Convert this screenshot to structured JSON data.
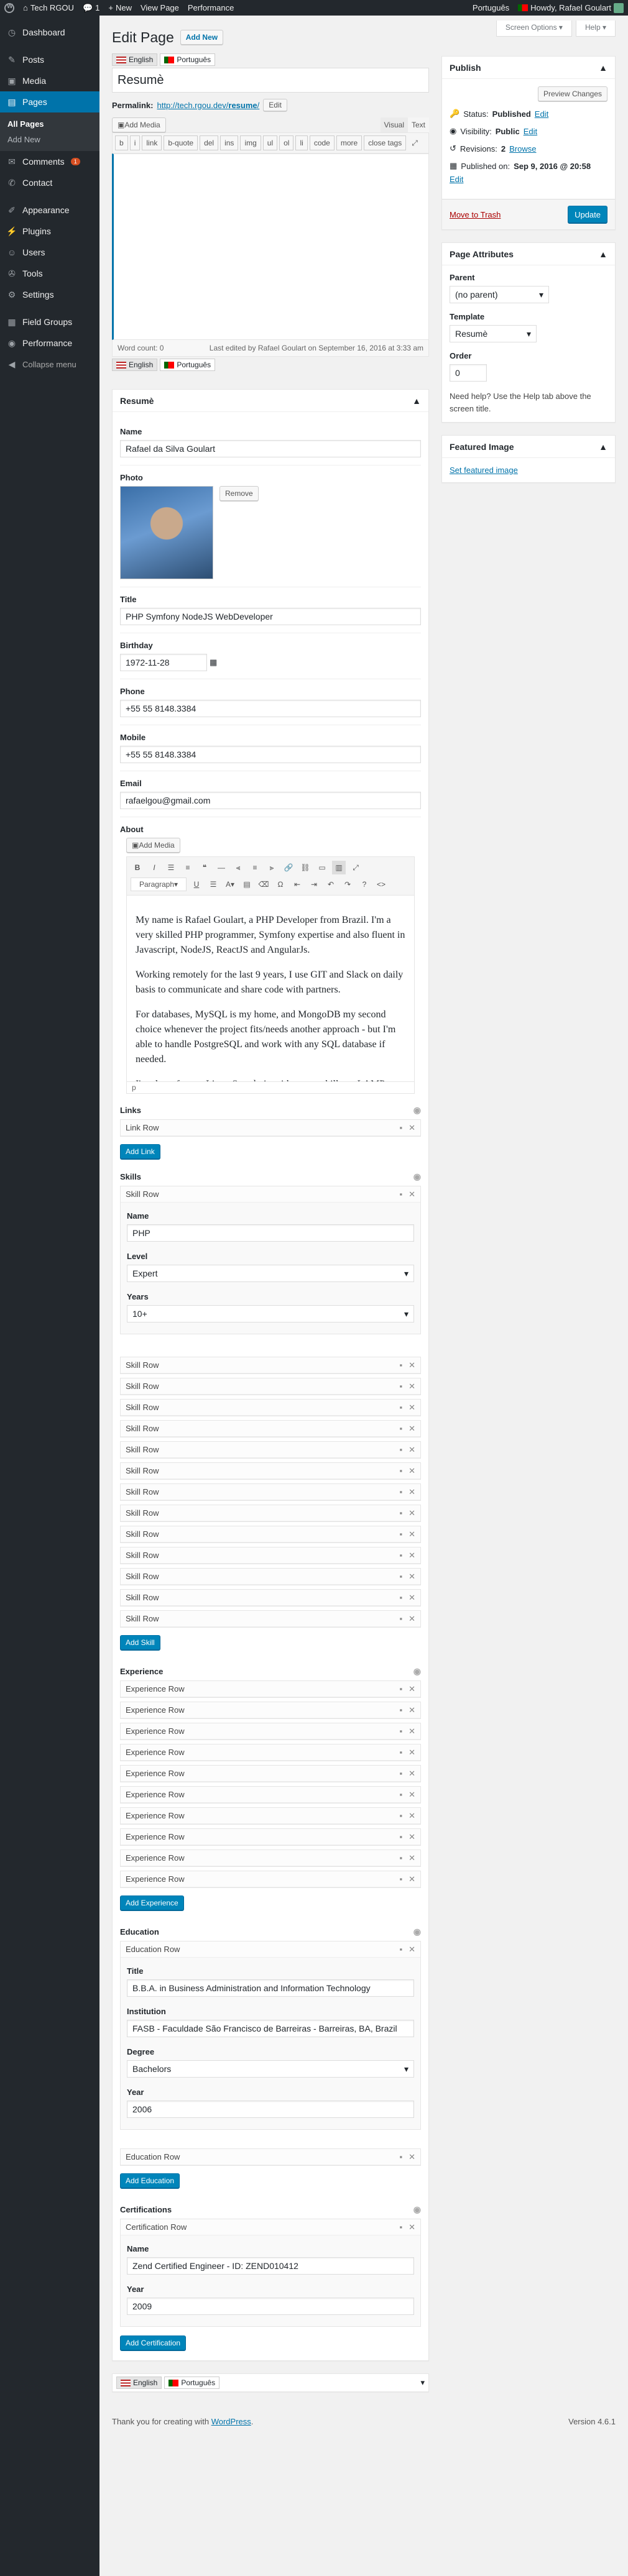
{
  "adminbar": {
    "site": "Tech RGOU",
    "comments": "1",
    "new": "New",
    "view_page": "View Page",
    "performance": "Performance",
    "language": "Português",
    "howdy": "Howdy, Rafael Goulart"
  },
  "sidebar": {
    "items": [
      {
        "label": "Dashboard",
        "icon": "dashboard-icon"
      },
      {
        "label": "Posts",
        "icon": "pin-icon"
      },
      {
        "label": "Media",
        "icon": "media-icon"
      },
      {
        "label": "Pages",
        "icon": "pages-icon"
      }
    ],
    "pages_sub": [
      "All Pages",
      "Add New"
    ],
    "items2": [
      {
        "label": "Comments",
        "icon": "comment-icon",
        "badge": "1"
      },
      {
        "label": "Contact",
        "icon": "mail-icon"
      }
    ],
    "items3": [
      {
        "label": "Appearance",
        "icon": "brush-icon"
      },
      {
        "label": "Plugins",
        "icon": "plug-icon"
      },
      {
        "label": "Users",
        "icon": "users-icon"
      },
      {
        "label": "Tools",
        "icon": "wrench-icon"
      },
      {
        "label": "Settings",
        "icon": "settings-icon"
      }
    ],
    "items4": [
      {
        "label": "Field Groups",
        "icon": "fieldgroups-icon"
      },
      {
        "label": "Performance",
        "icon": "performance-icon"
      },
      {
        "label": "Collapse menu",
        "icon": "collapse-icon"
      }
    ]
  },
  "screen_options": "Screen Options ▾",
  "help": "Help ▾",
  "heading": "Edit Page",
  "add_new": "Add New",
  "lang": {
    "en": "English",
    "pt": "Português"
  },
  "title_value": "Resumè",
  "permalink": {
    "label": "Permalink:",
    "url_base": "http://tech.rgou.dev/",
    "slug": "resume",
    "edit": "Edit"
  },
  "add_media": "Add Media",
  "visual": "Visual",
  "text": "Text",
  "quicktags": [
    "b",
    "i",
    "link",
    "b-quote",
    "del",
    "ins",
    "img",
    "ul",
    "ol",
    "li",
    "code",
    "more",
    "close tags"
  ],
  "word_count": "Word count: 0",
  "last_edited": "Last edited by Rafael Goulart on September 16, 2016 at 3:33 am",
  "resume_box": "Resumè",
  "fields": {
    "name_label": "Name",
    "name": "Rafael da Silva Goulart",
    "photo_label": "Photo",
    "remove": "Remove",
    "title_label": "Title",
    "title": "PHP Symfony NodeJS WebDeveloper",
    "birthday_label": "Birthday",
    "birthday": "1972-11-28",
    "phone_label": "Phone",
    "phone": "+55 55  8148.3384",
    "mobile_label": "Mobile",
    "mobile": "+55 55  8148.3384",
    "email_label": "Email",
    "email": "rafaelgou@gmail.com",
    "about_label": "About"
  },
  "rte": {
    "paragraph": "Paragraph",
    "p": "p",
    "paras": [
      "My name is Rafael Goulart, a PHP Developer from Brazil. I'm a very skilled PHP programmer, Symfony expertise and also fluent in Javascript, NodeJS, ReactJS and AngularJs.",
      "Working remotely for the last 9 years, I use GIT and Slack on daily basis to communicate and share code with partners.",
      "For databases, MySQL is my home, and MongoDB my second choice whenever the project fits/needs another approach - but I'm able to handle PostgreSQL and work with any SQL database if needed.",
      "I'm also a former Linux Sysadmin with strong skills on LAMP"
    ]
  },
  "links": {
    "label": "Links",
    "row": "Link Row",
    "add": "Add Link"
  },
  "skills": {
    "label": "Skills",
    "row": "Skill Row",
    "name_label": "Name",
    "name": "PHP",
    "level_label": "Level",
    "level": "Expert",
    "years_label": "Years",
    "years": "10+",
    "collapsed_count": 13,
    "add": "Add Skill"
  },
  "experience": {
    "label": "Experience",
    "row": "Experience Row",
    "count": 10,
    "add": "Add Experience"
  },
  "education": {
    "label": "Education",
    "row": "Education Row",
    "title_label": "Title",
    "title": "B.B.A. in Business Administration and Information Technology",
    "inst_label": "Institution",
    "inst": "FASB - Faculdade São Francisco de Barreiras - Barreiras, BA, Brazil",
    "degree_label": "Degree",
    "degree": "Bachelors",
    "year_label": "Year",
    "year": "2006",
    "add": "Add Education"
  },
  "certifications": {
    "label": "Certifications",
    "row": "Certification Row",
    "name_label": "Name",
    "name": "Zend Certified Engineer - ID: ZEND010412",
    "year_label": "Year",
    "year": "2009",
    "add": "Add Certification"
  },
  "publish": {
    "title": "Publish",
    "preview": "Preview Changes",
    "status_label": "Status:",
    "status": "Published",
    "edit": "Edit",
    "visibility_label": "Visibility:",
    "visibility": "Public",
    "revisions_label": "Revisions:",
    "revisions": "2",
    "browse": "Browse",
    "published_label": "Published on:",
    "published": "Sep 9, 2016 @ 20:58",
    "trash": "Move to Trash",
    "update": "Update"
  },
  "attributes": {
    "title": "Page Attributes",
    "parent_label": "Parent",
    "parent": "(no parent)",
    "template_label": "Template",
    "template": "Resumè",
    "order_label": "Order",
    "order": "0",
    "help": "Need help? Use the Help tab above the screen title."
  },
  "featured": {
    "title": "Featured Image",
    "link": "Set featured image"
  },
  "footer": {
    "thanks": "Thank you for creating with",
    "wp": "WordPress",
    "version": "Version 4.6.1"
  },
  "colors": {
    "accent": "#0073aa",
    "sidebar": "#23282d",
    "primary_btn": "#0085ba"
  }
}
